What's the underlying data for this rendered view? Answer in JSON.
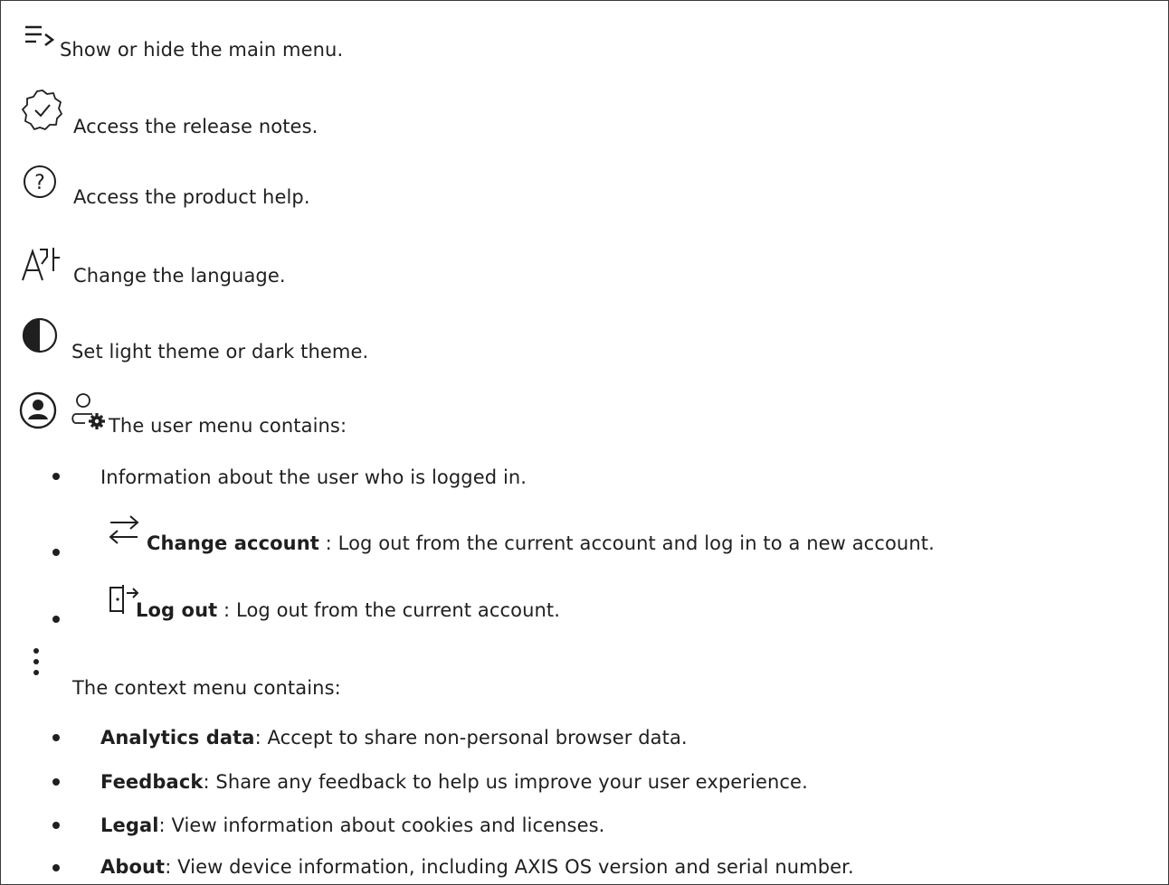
{
  "top_items": [
    {
      "icon": "menu-toggle-icon",
      "text": "Show or hide the main menu."
    },
    {
      "icon": "release-notes-icon",
      "text": "Access the release notes."
    },
    {
      "icon": "help-icon",
      "text": "Access the product help."
    },
    {
      "icon": "language-icon",
      "text": "Change the language."
    },
    {
      "icon": "theme-icon",
      "text": "Set light theme or dark theme."
    }
  ],
  "user_menu": {
    "icons": [
      "user-avatar-icon",
      "user-settings-icon"
    ],
    "text": "The user menu contains:",
    "items": [
      {
        "text": "Information about the user who is logged in."
      },
      {
        "icon": "change-account-icon",
        "title": "Change account",
        "text": " : Log out from the current account and log in to a new account."
      },
      {
        "icon": "log-out-icon",
        "title": "Log out",
        "text": " : Log out from the current account."
      }
    ]
  },
  "context_menu": {
    "icon": "more-vertical-icon",
    "text": "The context menu contains:",
    "items": [
      {
        "title": "Analytics data",
        "text": ": Accept to share non-personal browser data."
      },
      {
        "title": "Feedback",
        "text": ": Share any feedback to help us improve your user experience."
      },
      {
        "title": "Legal",
        "text": ": View information about cookies and licenses."
      },
      {
        "title": "About",
        "text": ": View device information, including AXIS OS version and serial number."
      }
    ]
  }
}
